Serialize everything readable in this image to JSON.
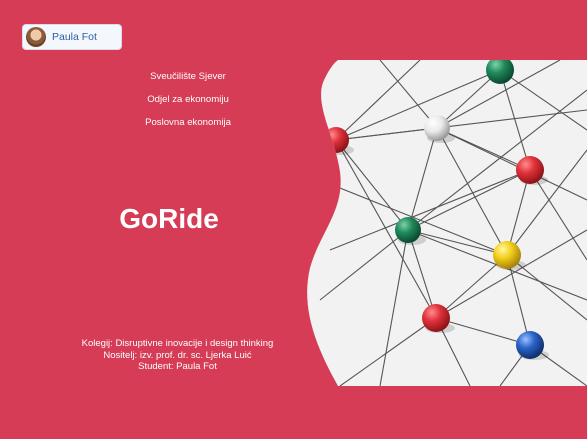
{
  "header": {
    "user_name": "Paula Fot"
  },
  "slide": {
    "institution_lines": [
      "Sveučilište Sjever",
      "Odjel za ekonomiju",
      "Poslovna ekonomija"
    ],
    "title": "GoRide",
    "credits": [
      "Kolegij: Disruptivne inovacije i design thinking",
      "Nositelj: izv. prof. dr. sc. Ljerka Luić",
      "Student: Paula Fot"
    ]
  },
  "colors": {
    "brand_red": "#d63c55",
    "pin_red": "#e0323b",
    "pin_green": "#1f8a5c",
    "pin_yellow": "#f3cf1a",
    "pin_blue": "#2a63c8",
    "pin_white": "#f2f2f2"
  },
  "icons": {
    "avatar": "user-avatar-photo"
  }
}
